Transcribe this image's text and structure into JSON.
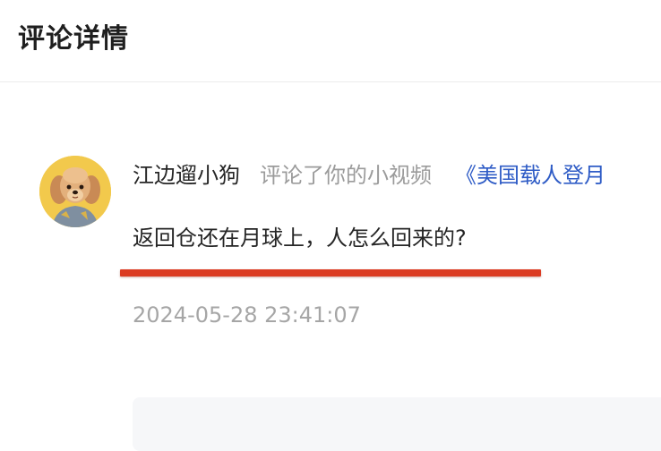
{
  "header": {
    "title": "评论详情"
  },
  "comment": {
    "username": "江边遛小狗",
    "action": "评论了你的小视频",
    "video_link": "《美国载人登月",
    "text": "返回仓还在月球上，人怎么回来的?",
    "timestamp": "2024-05-28 23:41:07",
    "avatar_icon": "dog-avatar-icon"
  },
  "colors": {
    "link": "#2f5cc6",
    "highlight_underline": "#db3b22",
    "muted_text": "#9b9b9b"
  }
}
